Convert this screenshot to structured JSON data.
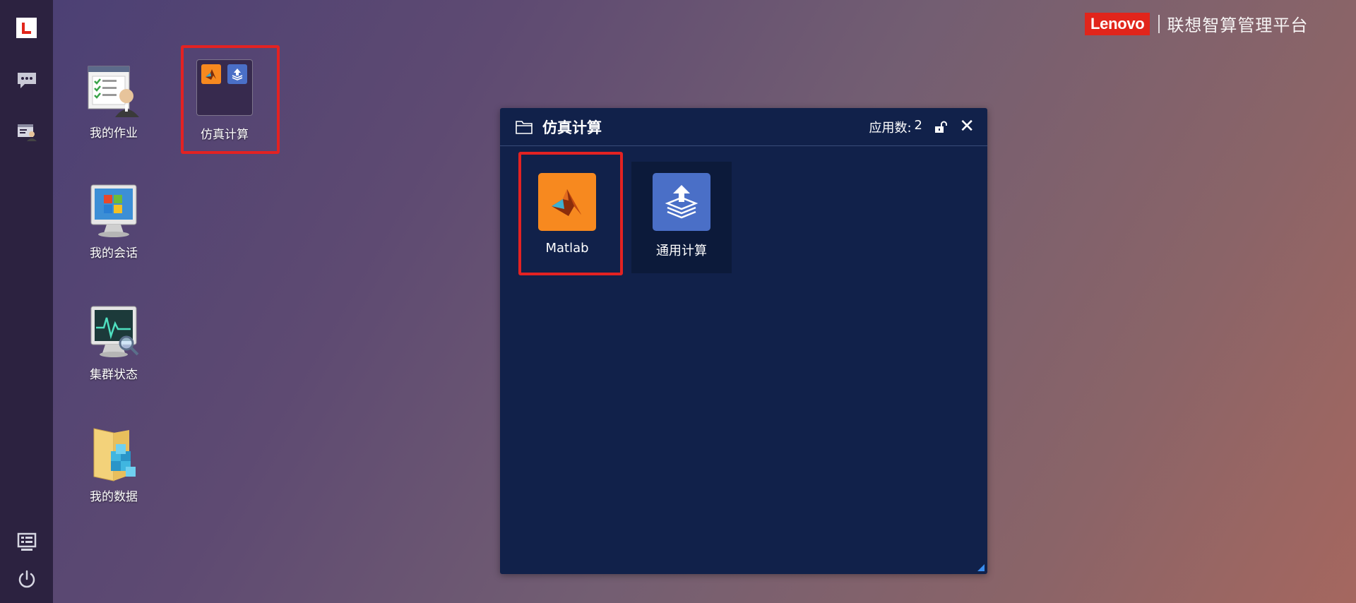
{
  "brand": {
    "logo_text": "Lenovo",
    "platform_name": "联想智算管理平台",
    "colors": {
      "brand_red": "#e1251b"
    }
  },
  "sidebar": {
    "items": [
      {
        "name": "logo",
        "icon": "lenovo-l-logo"
      },
      {
        "name": "messages",
        "icon": "chat-icon"
      },
      {
        "name": "user-panel",
        "icon": "user-console-icon"
      },
      {
        "name": "monitor",
        "icon": "monitor-icon"
      },
      {
        "name": "power",
        "icon": "power-icon"
      }
    ]
  },
  "desktop": {
    "icons": [
      {
        "label": "我的作业",
        "icon": "job-list-icon"
      },
      {
        "label": "仿真计算",
        "icon": "app-folder-icon"
      },
      {
        "label": "我的会话",
        "icon": "session-monitor-icon"
      },
      {
        "label": "集群状态",
        "icon": "cluster-status-icon"
      },
      {
        "label": "我的数据",
        "icon": "data-folder-icon"
      }
    ]
  },
  "window": {
    "title": "仿真计算",
    "count_label": "应用数:",
    "count_value": "2",
    "apps": [
      {
        "name": "Matlab",
        "icon": "matlab-icon",
        "color": "#f7891f"
      },
      {
        "name": "通用计算",
        "icon": "upload-stack-icon",
        "color": "#4a6fc7"
      }
    ]
  },
  "highlight_color": "#e32222"
}
